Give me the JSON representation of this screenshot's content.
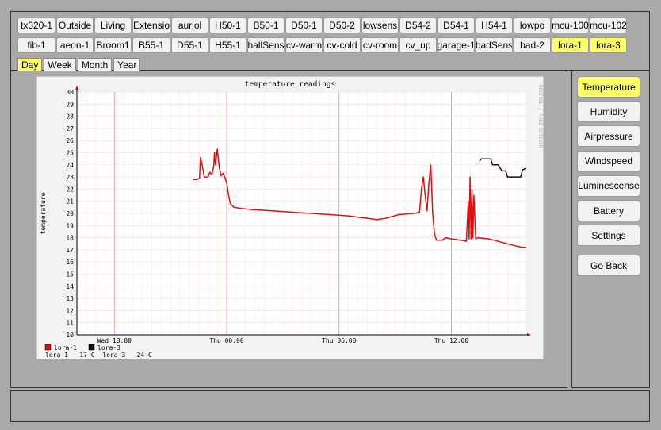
{
  "sensor_row1": [
    "tx320-1",
    "Outside",
    "Living",
    "Extensio",
    "auriol",
    "H50-1",
    "B50-1",
    "D50-1",
    "D50-2",
    "lowsens",
    "D54-2",
    "D54-1",
    "H54-1",
    "lowpo",
    "mcu-100",
    "mcu-102"
  ],
  "sensor_row2": [
    "fib-1",
    "aeon-1",
    "Broom1",
    "B55-1",
    "D55-1",
    "H55-1",
    "hallSens",
    "cv-warm",
    "cv-cold",
    "cv-room",
    "cv_up",
    "garage-1",
    "badSens",
    "bad-2",
    "lora-1",
    "lora-3"
  ],
  "highlighted_sensors": [
    "lora-1",
    "lora-3"
  ],
  "tabs": [
    "Day",
    "Week",
    "Month",
    "Year"
  ],
  "active_tab": "Day",
  "side_buttons": [
    "Temperature",
    "Humidity",
    "Airpressure",
    "Windspeed",
    "Luminescense",
    "Battery",
    "Settings"
  ],
  "active_side_button": "Temperature",
  "go_back_label": "Go Back",
  "colors": {
    "highlight": "#ffff66",
    "series_lora1": "#dd1111",
    "series_lora3": "#111111",
    "grid": "#f4b4b4"
  },
  "chart_data": {
    "type": "line",
    "title": "temperature readings",
    "ylabel": "temperature",
    "xlabel": "",
    "watermark": "RRDTOOL / TOBI OETIKER",
    "ylim": [
      10,
      30
    ],
    "y_ticks": [
      10,
      11,
      12,
      13,
      14,
      15,
      16,
      17,
      18,
      19,
      20,
      21,
      22,
      23,
      24,
      25,
      26,
      27,
      28,
      29,
      30
    ],
    "x_range_hours": [
      16,
      40
    ],
    "x_ticks": [
      {
        "x": 18,
        "label": "Wed 18:00"
      },
      {
        "x": 24,
        "label": "Thu 00:00"
      },
      {
        "x": 30,
        "label": "Thu 06:00"
      },
      {
        "x": 36,
        "label": "Thu 12:00"
      }
    ],
    "legend_position": "bottom-left",
    "legend": [
      {
        "name": "lora-1",
        "color": "#dd1111"
      },
      {
        "name": "lora-3",
        "color": "#111111"
      }
    ],
    "summary": "lora-1   17 C  lora-3   24 C",
    "series": [
      {
        "name": "lora-1",
        "color": "#dd1111",
        "points": [
          [
            22.2,
            22.8
          ],
          [
            22.4,
            22.8
          ],
          [
            22.55,
            22.9
          ],
          [
            22.6,
            24.6
          ],
          [
            22.7,
            23.9
          ],
          [
            22.8,
            23.0
          ],
          [
            23.0,
            23.0
          ],
          [
            23.1,
            23.4
          ],
          [
            23.2,
            23.2
          ],
          [
            23.3,
            23.8
          ],
          [
            23.35,
            25.0
          ],
          [
            23.4,
            24.0
          ],
          [
            23.5,
            25.3
          ],
          [
            23.6,
            23.8
          ],
          [
            23.7,
            23.1
          ],
          [
            23.8,
            23.3
          ],
          [
            23.9,
            23.0
          ],
          [
            24.0,
            22.5
          ],
          [
            24.1,
            21.5
          ],
          [
            24.2,
            20.8
          ],
          [
            24.4,
            20.5
          ],
          [
            24.8,
            20.4
          ],
          [
            25.5,
            20.3
          ],
          [
            26.5,
            20.2
          ],
          [
            27.5,
            20.1
          ],
          [
            28.5,
            20.0
          ],
          [
            29.5,
            19.9
          ],
          [
            30.5,
            19.8
          ],
          [
            31.5,
            19.6
          ],
          [
            32.0,
            19.5
          ],
          [
            32.5,
            19.6
          ],
          [
            33.2,
            19.9
          ],
          [
            34.0,
            20.0
          ],
          [
            34.3,
            20.1
          ],
          [
            34.4,
            22.0
          ],
          [
            34.5,
            23.0
          ],
          [
            34.6,
            21.5
          ],
          [
            34.7,
            20.2
          ],
          [
            34.8,
            22.5
          ],
          [
            34.9,
            24.0
          ],
          [
            35.0,
            20.0
          ],
          [
            35.1,
            18.3
          ],
          [
            35.2,
            17.8
          ],
          [
            35.5,
            17.8
          ],
          [
            35.7,
            18.0
          ],
          [
            36.0,
            17.9
          ],
          [
            36.5,
            17.8
          ],
          [
            36.8,
            17.7
          ],
          [
            36.9,
            21.0
          ],
          [
            36.95,
            17.9
          ],
          [
            37.0,
            23.0
          ],
          [
            37.05,
            17.9
          ],
          [
            37.1,
            22.0
          ],
          [
            37.15,
            18.0
          ],
          [
            37.2,
            21.5
          ],
          [
            37.3,
            17.9
          ],
          [
            37.4,
            18.0
          ],
          [
            38.0,
            17.9
          ],
          [
            38.5,
            17.7
          ],
          [
            39.0,
            17.5
          ],
          [
            39.5,
            17.3
          ],
          [
            39.8,
            17.2
          ],
          [
            40.0,
            17.2
          ]
        ]
      },
      {
        "name": "lora-3",
        "color": "#111111",
        "points": [
          [
            37.5,
            24.3
          ],
          [
            37.6,
            24.5
          ],
          [
            38.1,
            24.5
          ],
          [
            38.2,
            24.0
          ],
          [
            38.5,
            24.0
          ],
          [
            38.7,
            23.5
          ],
          [
            38.9,
            23.5
          ],
          [
            39.0,
            23.0
          ],
          [
            39.5,
            23.0
          ],
          [
            39.7,
            23.0
          ],
          [
            39.8,
            23.6
          ],
          [
            40.0,
            23.7
          ]
        ]
      }
    ]
  }
}
